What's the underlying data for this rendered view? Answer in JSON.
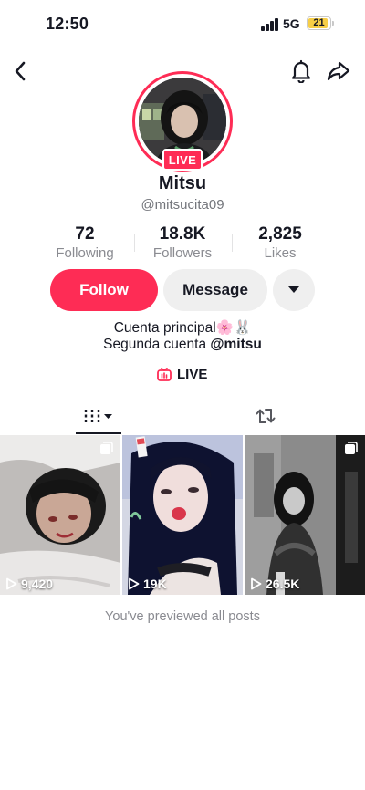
{
  "status_bar": {
    "time": "12:50",
    "network": "5G",
    "battery": "21"
  },
  "profile": {
    "display_name": "Mitsu",
    "username": "@mitsucita09",
    "live_badge": "LIVE",
    "stats": [
      {
        "value": "72",
        "label": "Following"
      },
      {
        "value": "18.8K",
        "label": "Followers"
      },
      {
        "value": "2,825",
        "label": "Likes"
      }
    ],
    "bio_line1": "Cuenta principal🌸🐰",
    "bio_line2_prefix": "Segunda cuenta ",
    "bio_line2_mention": "@mitsu",
    "live_link_label": "LIVE"
  },
  "actions": {
    "follow_label": "Follow",
    "message_label": "Message"
  },
  "tabs": {
    "videos_icon": "grid-icon",
    "repost_icon": "repost-icon"
  },
  "posts": [
    {
      "views": "9,420"
    },
    {
      "views": "19K"
    },
    {
      "views": "26.5K"
    }
  ],
  "footer_note": "You've previewed all posts",
  "colors": {
    "accent": "#fe2c55",
    "secondary_button": "#efefef",
    "muted_text": "#8a8b91"
  }
}
